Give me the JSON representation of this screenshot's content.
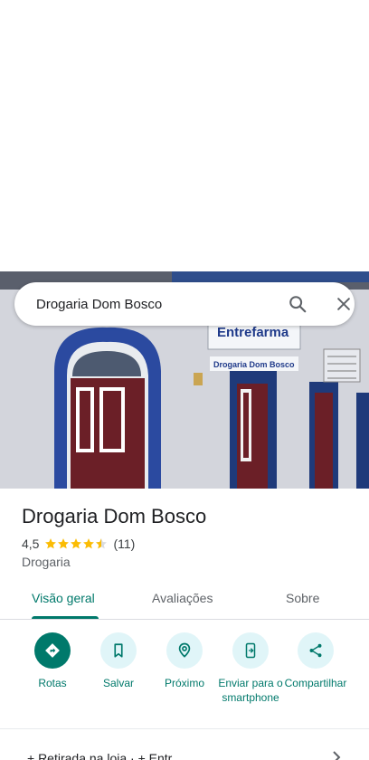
{
  "search": {
    "query": "Drogaria Dom Bosco"
  },
  "photo": {
    "sign_brand": "Entrefarma",
    "sign_name": "Drogaria Dom Bosco"
  },
  "place": {
    "title": "Drogaria Dom Bosco",
    "rating": "4,5",
    "stars_value": 4.5,
    "reviews": "(11)",
    "category": "Drogaria"
  },
  "tabs": [
    {
      "label": "Visão geral",
      "active": true
    },
    {
      "label": "Avaliações",
      "active": false
    },
    {
      "label": "Sobre",
      "active": false
    }
  ],
  "actions": [
    {
      "label": "Rotas",
      "icon": "directions-icon"
    },
    {
      "label": "Salvar",
      "icon": "bookmark-icon"
    },
    {
      "label": "Próximo",
      "icon": "nearby-icon"
    },
    {
      "label": "Enviar para o smartphone",
      "icon": "send-to-phone-icon"
    },
    {
      "label": "Compartilhar",
      "icon": "share-icon"
    }
  ],
  "bottom": {
    "text": "+ Retirada na loja · + Entr"
  },
  "colors": {
    "accent": "#00796b",
    "action_bg": "#e0f5f8",
    "star": "#fbbc04"
  }
}
